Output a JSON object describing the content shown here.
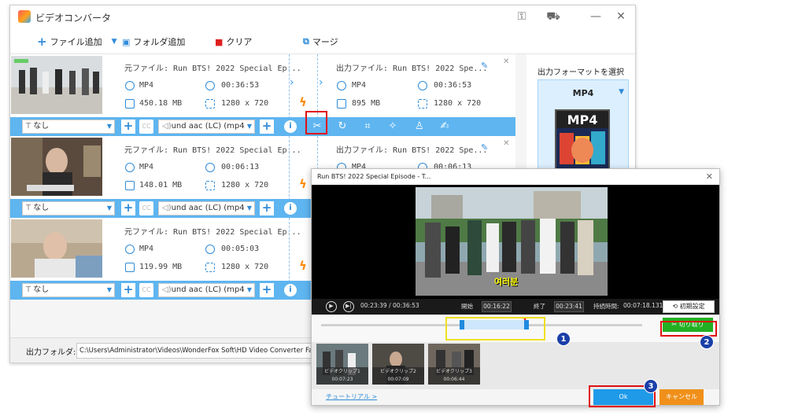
{
  "app": {
    "title": "ビデオコンバータ"
  },
  "toolbar": {
    "add_file": "ファイル追加",
    "add_folder": "フォルダ追加",
    "clear": "クリア",
    "merge": "マージ"
  },
  "files": [
    {
      "src_label": "元ファイル: Run BTS! 2022 Special Ep...",
      "dst_label": "出力ファイル: Run BTS! 2022 Spe...",
      "src_fmt": "MP4",
      "src_dur": "00:36:53",
      "src_size": "450.18 MB",
      "src_res": "1280 x 720",
      "dst_fmt": "MP4",
      "dst_dur": "00:36:53",
      "dst_size": "895 MB",
      "dst_res": "1280 x 720",
      "subtitle": "なし",
      "audio": "und aac (LC) (mp4"
    },
    {
      "src_label": "元ファイル: Run BTS! 2022 Special Ep...",
      "dst_label": "出力ファイル: Run BTS! 2022 Spe...",
      "src_fmt": "MP4",
      "src_dur": "00:06:13",
      "src_size": "148.01 MB",
      "src_res": "1280 x 720",
      "dst_fmt": "MP4",
      "dst_dur": "00:06:13",
      "subtitle": "なし",
      "audio": "und aac (LC) (mp4"
    },
    {
      "src_label": "元ファイル: Run BTS! 2022 Special Ep...",
      "src_fmt": "MP4",
      "src_dur": "00:05:03",
      "src_size": "119.99 MB",
      "src_res": "1280 x 720",
      "subtitle": "なし",
      "audio": "und aac (LC) (mp4"
    }
  ],
  "right_panel": {
    "label": "出力フォーマットを選択",
    "format": "MP4",
    "art_text": "MP4"
  },
  "output": {
    "label": "出力フォルダ:",
    "path": "C:\\Users\\Administrator\\Videos\\WonderFox Soft\\HD Video Converter Factory Pro\\OutputVideo"
  },
  "dialog": {
    "title": "Run BTS! 2022 Special Episode - T...",
    "caption": "여러분",
    "time": "00:23:39 / 00:36:53",
    "start_label": "開始",
    "start_value": "00:16:22",
    "end_label": "終了",
    "end_value": "00:23:41",
    "duration_label": "持続時間:",
    "duration_value": "00:07:18.131",
    "reset": "初期設定",
    "cut": "切り取り",
    "clips": [
      {
        "name": "ビデオクリップ1",
        "time": "00:07:23"
      },
      {
        "name": "ビデオクリップ2",
        "time": "00:07:09"
      },
      {
        "name": "ビデオクリップ3",
        "time": "00:06:44"
      }
    ],
    "tutorial": "チュートリアル >",
    "ok": "Ok",
    "cancel": "キャンセル"
  },
  "badges": [
    "1",
    "2",
    "3"
  ],
  "colors": {
    "accent": "#5eb5f0",
    "highlight_red": "#e01010",
    "highlight_yellow": "#f0e020",
    "cut_green": "#22b022",
    "cancel_orange": "#f0901a",
    "ok_blue": "#1e9ae8",
    "badge_blue": "#1a3fa8"
  },
  "icons": {
    "scissors": "scissors-icon",
    "rotate": "rotate-icon",
    "crop": "crop-icon",
    "effects": "magic-wand-icon",
    "watermark": "stamp-icon",
    "subtitle_edit": "brush-icon"
  }
}
